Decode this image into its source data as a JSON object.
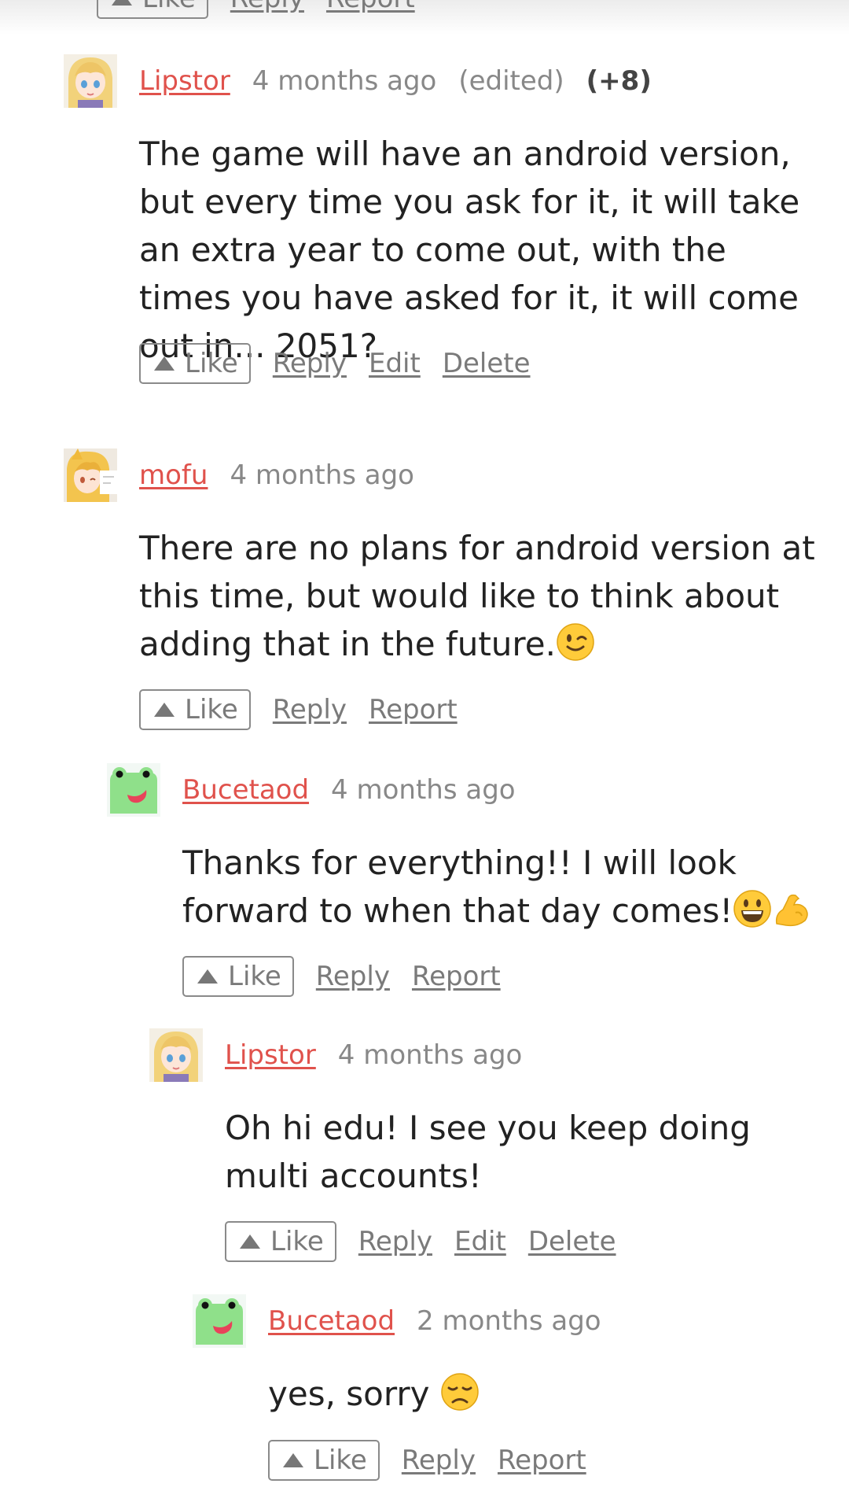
{
  "top_partial": {
    "like": "Like",
    "reply": "Reply",
    "report": "Report"
  },
  "comments": [
    {
      "author": "Lipstor",
      "time": "4 months ago",
      "edited": "(edited)",
      "score": "(+8)",
      "body": "The game will have an android version, but every time you ask for it, it will take an extra year to come out, with the times you have asked for it, it will come out in... 2051?",
      "actions": {
        "like": "Like",
        "reply": "Reply",
        "edit": "Edit",
        "delete": "Delete"
      }
    },
    {
      "author": "mofu",
      "time": "4 months ago",
      "body": "There are no plans for android version at this time, but would like to think about adding that in the future.",
      "body_emoji": "winking-face",
      "actions": {
        "like": "Like",
        "reply": "Reply",
        "report": "Report"
      }
    },
    {
      "author": "Bucetaod",
      "time": "4 months ago",
      "body": "Thanks for everything!! I will look forward to when that day comes!",
      "body_emoji": [
        "grinning-face",
        "flexed-biceps"
      ],
      "actions": {
        "like": "Like",
        "reply": "Reply",
        "report": "Report"
      }
    },
    {
      "author": "Lipstor",
      "time": "4 months ago",
      "body": "Oh hi edu! I see you keep doing multi accounts!",
      "actions": {
        "like": "Like",
        "reply": "Reply",
        "edit": "Edit",
        "delete": "Delete"
      }
    },
    {
      "author": "Bucetaod",
      "time": "2 months ago",
      "body": "yes, sorry",
      "body_emoji": "disappointed-face",
      "actions": {
        "like": "Like",
        "reply": "Reply",
        "report": "Report"
      }
    }
  ],
  "colors": {
    "author_link": "#e0524c",
    "muted_text": "#888888",
    "body_text": "#222222",
    "button_border": "#8a8a8a"
  }
}
